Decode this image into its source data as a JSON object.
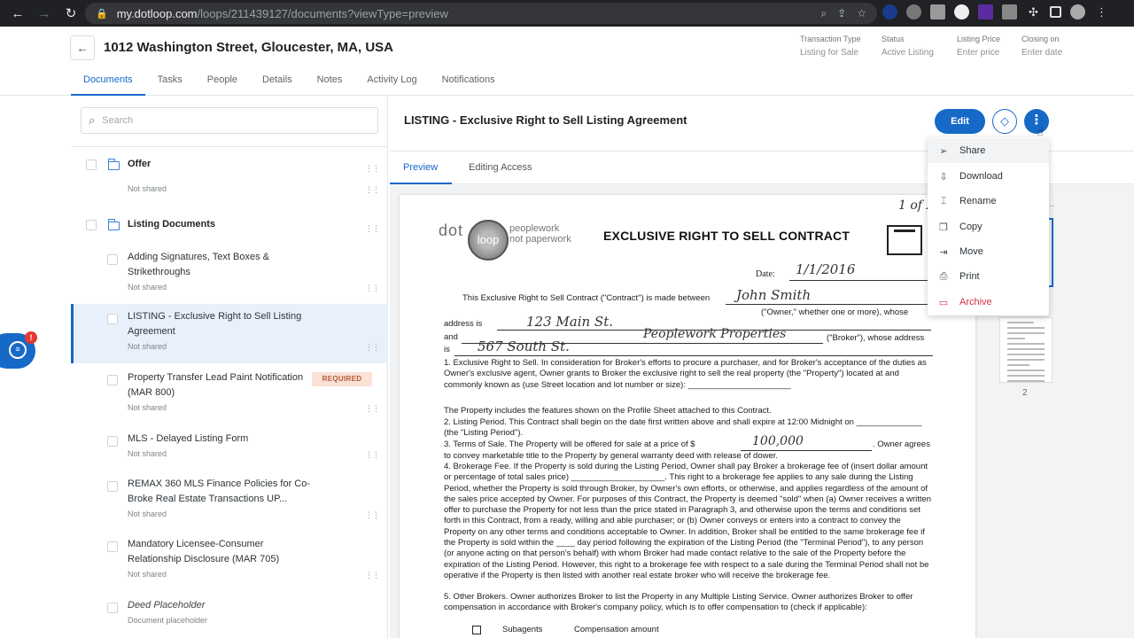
{
  "browser": {
    "url_host": "my.dotloop.com",
    "url_path": "/loops/211439127/documents?viewType=preview"
  },
  "header": {
    "title": "1012 Washington Street, Gloucester, MA, USA",
    "meta": [
      {
        "label": "Transaction Type",
        "value": "Listing for Sale"
      },
      {
        "label": "Status",
        "value": "Active Listing"
      },
      {
        "label": "Listing Price",
        "value": "Enter price"
      },
      {
        "label": "Closing on",
        "value": "Enter date"
      }
    ],
    "tabs": [
      "Documents",
      "Tasks",
      "People",
      "Details",
      "Notes",
      "Activity Log",
      "Notifications"
    ]
  },
  "sidebar": {
    "search_placeholder": "Search",
    "items": [
      {
        "name": "Offer",
        "status": "Not shared"
      },
      {
        "name": "Listing Documents"
      },
      {
        "name": "Adding Signatures, Text Boxes & Strikethroughs",
        "status": "Not shared"
      },
      {
        "name": "LISTING - Exclusive Right to Sell Listing Agreement",
        "status": "Not shared"
      },
      {
        "name": "Property Transfer Lead Paint Notification (MAR 800)",
        "status": "Not shared",
        "badge": "REQUIRED"
      },
      {
        "name": "MLS - Delayed Listing Form",
        "status": "Not shared"
      },
      {
        "name": "REMAX 360 MLS Finance Policies for Co-Broke Real Estate Transactions UP...",
        "status": "Not shared"
      },
      {
        "name": "Mandatory Licensee-Consumer Relationship Disclosure (MAR 705)",
        "status": "Not shared"
      },
      {
        "name": "Deed Placeholder",
        "status": "Document placeholder"
      }
    ],
    "chat_badge": "!"
  },
  "document": {
    "title": "LISTING - Exclusive Right to Sell Listing Agreement",
    "edit_label": "Edit",
    "tabs": [
      "Preview",
      "Editing Access"
    ],
    "thumb_page": "2"
  },
  "menu": {
    "items": [
      {
        "label": "Share",
        "icon": "share-icon"
      },
      {
        "label": "Download",
        "icon": "download-icon"
      },
      {
        "label": "Rename",
        "icon": "rename-icon"
      },
      {
        "label": "Copy",
        "icon": "copy-icon"
      },
      {
        "label": "Move",
        "icon": "move-icon"
      },
      {
        "label": "Print",
        "icon": "print-icon"
      },
      {
        "label": "Archive",
        "icon": "archive-icon"
      }
    ]
  },
  "pdf": {
    "brand": "dot",
    "brand_mid": "loop",
    "tagline1": "peoplework",
    "tagline2": "not paperwork",
    "title": "EXCLUSIVE RIGHT TO SELL CONTRACT",
    "page_note": "1 of 2",
    "date_label": "Date:",
    "date_value": "1/1/2016",
    "line_intro": "This Exclusive Right to Sell Contract (\"Contract\") is made between",
    "owner_name": "John Smith",
    "owner_suffix": "(\"Owner,\" whether one or more), whose",
    "address_label": "address is",
    "address_value": "123 Main St.",
    "and_label": "and",
    "broker_name": "Peoplework Properties",
    "broker_suffix": "(\"Broker\"), whose address",
    "is_label": "is",
    "broker_address": "567 South St.",
    "p1": "1. Exclusive Right to Sell. In consideration for Broker's efforts to procure a purchaser, and for Broker's acceptance of the duties as Owner's exclusive agent, Owner grants to Broker the exclusive right to sell the real property (the \"Property\") located at and commonly known as (use Street location and lot number or size): ______________________",
    "p1b": "The Property includes the features shown on the Profile Sheet attached to this Contract.",
    "p2": "2. Listing Period. This Contract shall begin on the date first written above and shall expire at 12:00 Midnight on ______________ (the \"Listing Period\").",
    "p3a": "3. Terms of Sale. The Property will be offered for sale at a price of $",
    "price": "100,000",
    "p3b": ". Owner agrees to convey marketable title to the Property by general warranty deed with release of dower.",
    "p4": "4. Brokerage Fee. If the Property is sold during the Listing Period, Owner shall pay Broker a brokerage fee of (insert dollar amount or percentage of total sales price) ____________________. This right to a brokerage fee applies to any sale during the Listing Period, whether the Property is sold through Broker, by Owner's own efforts, or otherwise, and applies regardless of the amount of the sales price accepted by Owner. For purposes of this Contract, the Property is deemed \"sold\" when (a) Owner receives a written offer to purchase the Property for not less than the price stated in Paragraph 3, and otherwise upon the terms and conditions set forth in this Contract, from a ready, willing and able purchaser; or (b) Owner conveys or enters into a contract to convey the Property on any other terms and conditions acceptable to Owner. In addition, Broker shall be entitled to the same brokerage fee if the Property is sold within the ____ day period following the expiration of the Listing Period (the \"Terminal Period\"), to any person (or anyone acting on that person's behalf) with whom Broker had made contact relative to the sale of the Property before the expiration of the Listing Period. However, this right to a brokerage fee with respect to a sale during the Terminal Period shall not be operative if the Property is then listed with another real estate broker who will receive the brokerage fee.",
    "p5": "5. Other Brokers. Owner authorizes Broker to list the Property in any Multiple Listing Service. Owner authorizes Broker to offer compensation in accordance with Broker's company policy, which is to offer compensation to (check if applicable):",
    "subagents": "Subagents",
    "comp": "Compensation amount"
  }
}
